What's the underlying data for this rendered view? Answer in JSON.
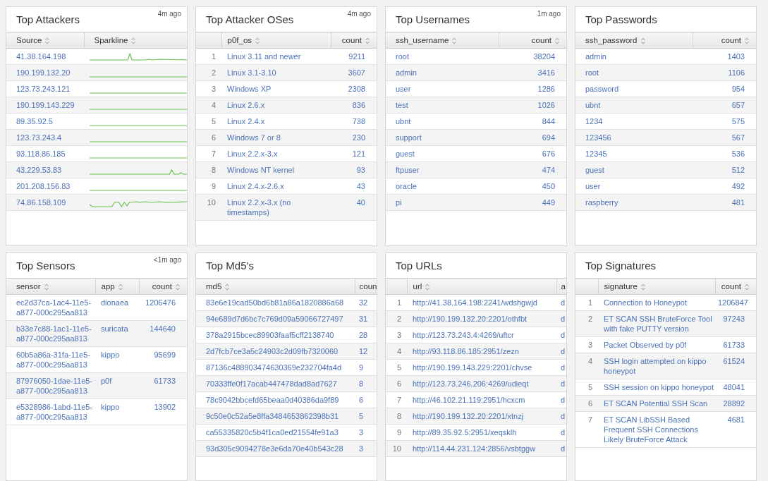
{
  "panels": [
    {
      "title": "Top Attackers",
      "updated": "4m ago",
      "columns": [
        {
          "label": "Source",
          "kind": "link",
          "sortable": true
        },
        {
          "label": "Sparkline",
          "kind": "sparkline",
          "sortable": true
        }
      ],
      "rows": [
        [
          "41.38.164.198"
        ],
        [
          "190.199.132.20"
        ],
        [
          "123.73.243.121"
        ],
        [
          "190.199.143.229"
        ],
        [
          "89.35.92.5"
        ],
        [
          "123.73.243.4"
        ],
        [
          "93.118.86.185"
        ],
        [
          "43.229.53.83"
        ],
        [
          "201.208.156.83"
        ],
        [
          "74.86.158.109"
        ]
      ]
    },
    {
      "title": "Top Attacker OSes",
      "updated": "4m ago",
      "columns": [
        {
          "kind": "index",
          "sortable": false
        },
        {
          "label": "p0f_os",
          "kind": "link",
          "sortable": true
        },
        {
          "label": "count",
          "kind": "number",
          "sortable": true
        }
      ],
      "rows": [
        [
          "1",
          "Linux 3.11 and newer",
          "9211"
        ],
        [
          "2",
          "Linux 3.1-3.10",
          "3607"
        ],
        [
          "3",
          "Windows XP",
          "2308"
        ],
        [
          "4",
          "Linux 2.6.x",
          "836"
        ],
        [
          "5",
          "Linux 2.4.x",
          "738"
        ],
        [
          "6",
          "Windows 7 or 8",
          "230"
        ],
        [
          "7",
          "Linux 2.2.x-3.x",
          "121"
        ],
        [
          "8",
          "Windows NT kernel",
          "93"
        ],
        [
          "9",
          "Linux 2.4.x-2.6.x",
          "43"
        ],
        [
          "10",
          "Linux 2.2.x-3.x (no timestamps)",
          "40"
        ]
      ]
    },
    {
      "title": "Top Usernames",
      "updated": "1m ago",
      "columns": [
        {
          "label": "ssh_username",
          "kind": "link",
          "sortable": true
        },
        {
          "label": "count",
          "kind": "number",
          "sortable": true
        }
      ],
      "rows": [
        [
          "root",
          "38204"
        ],
        [
          "admin",
          "3416"
        ],
        [
          "user",
          "1286"
        ],
        [
          "test",
          "1026"
        ],
        [
          "ubnt",
          "844"
        ],
        [
          "support",
          "694"
        ],
        [
          "guest",
          "676"
        ],
        [
          "ftpuser",
          "474"
        ],
        [
          "oracle",
          "450"
        ],
        [
          "pi",
          "449"
        ]
      ]
    },
    {
      "title": "Top Passwords",
      "columns": [
        {
          "label": "ssh_password",
          "kind": "link",
          "sortable": true
        },
        {
          "label": "count",
          "kind": "number",
          "sortable": true
        }
      ],
      "rows": [
        [
          "admin",
          "1403"
        ],
        [
          "root",
          "1106"
        ],
        [
          "password",
          "954"
        ],
        [
          "ubnt",
          "657"
        ],
        [
          "1234",
          "575"
        ],
        [
          "123456",
          "567"
        ],
        [
          "12345",
          "536"
        ],
        [
          "guest",
          "512"
        ],
        [
          "user",
          "492"
        ],
        [
          "raspberry",
          "481"
        ]
      ]
    },
    {
      "title": "Top Sensors",
      "updated": "<1m ago",
      "columns": [
        {
          "label": "sensor",
          "kind": "link",
          "sortable": true
        },
        {
          "label": "app",
          "kind": "link",
          "sortable": true
        },
        {
          "label": "count",
          "kind": "number",
          "sortable": true
        }
      ],
      "rows": [
        [
          "ec2d37ca-1ac4-11e5-a877-000c295aa813",
          "dionaea",
          "1206476"
        ],
        [
          "b33e7c88-1ac1-11e5-a877-000c295aa813",
          "suricata",
          "144640"
        ],
        [
          "60b5a86a-31fa-11e5-a877-000c295aa813",
          "kippo",
          "95699"
        ],
        [
          "87976050-1dae-11e5-a877-000c295aa813",
          "p0f",
          "61733"
        ],
        [
          "e5328986-1abd-11e5-a877-000c295aa813",
          "kippo",
          "13902"
        ]
      ]
    },
    {
      "title": "Top Md5's",
      "columns": [
        {
          "label": "md5",
          "kind": "link",
          "sortable": true
        },
        {
          "label": "coun",
          "kind": "clip",
          "sortable": false
        }
      ],
      "rows": [
        [
          "83e6e19cad50bd6b81a86a1820886a68",
          "32"
        ],
        [
          "94e689d7d6bc7c769d09a59066727497",
          "31"
        ],
        [
          "378a2915bcec89903faaf5cff2138740",
          "28"
        ],
        [
          "2d7fcb7ce3a5c24903c2d09fb7320060",
          "12"
        ],
        [
          "87136c488903474630369e232704fa4d",
          "9"
        ],
        [
          "70333ffe0f17acab447478dad8ad7627",
          "8"
        ],
        [
          "78c9042bbcefd65beaa0d40386da9f89",
          "6"
        ],
        [
          "9c50e0c52a5e8ffa3484653862398b31",
          "5"
        ],
        [
          "ca55335820c5b4f1ca0ed21554fe91a3",
          "3"
        ],
        [
          "93d305c9094278e3e6da70e40b543c28",
          "3"
        ]
      ]
    },
    {
      "title": "Top URLs",
      "columns": [
        {
          "kind": "index",
          "sortable": false
        },
        {
          "label": "url",
          "kind": "link",
          "sortable": true
        },
        {
          "label": "a",
          "kind": "clip",
          "sortable": false
        }
      ],
      "rows": [
        [
          "1",
          "http://41.38.164.198:2241/wdshgwjd",
          "d"
        ],
        [
          "2",
          "http://190.199.132.20:2201/othfbt",
          "d"
        ],
        [
          "3",
          "http://123.73.243.4:4269/uftcr",
          "d"
        ],
        [
          "4",
          "http://93.118.86.185:2951/zezn",
          "d"
        ],
        [
          "5",
          "http://190.199.143.229:2201/chvse",
          "d"
        ],
        [
          "6",
          "http://123.73.246.206:4269/udieqt",
          "d"
        ],
        [
          "7",
          "http://46.102.21.119:2951/hcxcm",
          "d"
        ],
        [
          "8",
          "http://190.199.132.20:2201/xtnzj",
          "d"
        ],
        [
          "9",
          "http://89.35.92.5:2951/xeqsklh",
          "d"
        ],
        [
          "10",
          "http://114.44.231.124:2856/vsbtggw",
          "d"
        ]
      ]
    },
    {
      "title": "Top Signatures",
      "columns": [
        {
          "kind": "index",
          "sortable": false
        },
        {
          "label": "signature",
          "kind": "link",
          "sortable": true
        },
        {
          "label": "count",
          "kind": "number",
          "sortable": true
        }
      ],
      "rows": [
        [
          "1",
          "Connection to Honeypot",
          "1206847"
        ],
        [
          "2",
          "ET SCAN SSH BruteForce Tool with fake PUTTY version",
          "97243"
        ],
        [
          "3",
          "Packet Observed by p0f",
          "61733"
        ],
        [
          "4",
          "SSH login attempted on kippo honeypot",
          "61524"
        ],
        [
          "5",
          "SSH session on kippo honeypot",
          "48041"
        ],
        [
          "6",
          "ET SCAN Potential SSH Scan",
          "28892"
        ],
        [
          "7",
          "ET SCAN LibSSH Based Frequent SSH Connections Likely BruteForce Attack",
          "4681"
        ]
      ]
    }
  ]
}
